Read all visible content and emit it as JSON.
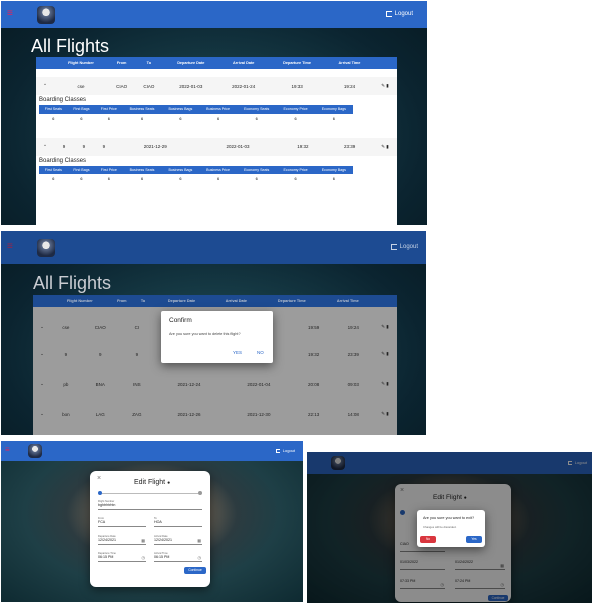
{
  "app": {
    "logout_label": "Logout",
    "page_title": "All Flights",
    "accent": "#2b67c7"
  },
  "flights_table": {
    "headers": [
      "Flight Number",
      "From",
      "To",
      "Departure Date",
      "Arrival Date",
      "Departure Time",
      "Arrival Time"
    ],
    "rows": [
      {
        "number": "cse",
        "from": "CIAO",
        "to": "CIAO",
        "dep_date": "2022-01-03",
        "arr_date": "2022-01-24",
        "dep_time": "19:33",
        "arr_time": "19:24"
      },
      {
        "number": "9",
        "from": "9",
        "to": "9",
        "dep_date": "2021-12-29",
        "arr_date": "2022-01-03",
        "dep_time": "19:32",
        "arr_time": "23:39"
      }
    ],
    "boarding_title": "Boarding Classes",
    "boarding_headers": [
      "First Seats",
      "First Bags",
      "First Price",
      "Business Seats",
      "Business Bags",
      "Business Price",
      "Economy Seats",
      "Economy Price",
      "Economy Bags"
    ],
    "boarding_values": [
      "6",
      "6",
      "6",
      "6",
      "6",
      "6",
      "6",
      "6",
      "6"
    ]
  },
  "delete_view": {
    "rows": [
      {
        "number": "cse",
        "from": "CIAO",
        "to": "CI",
        "dep_date": "",
        "arr_date": "",
        "dep_time": "19:59",
        "arr_time": "19:24"
      },
      {
        "number": "9",
        "from": "9",
        "to": "9",
        "dep_date": "2021-12-29",
        "arr_date": "2022-01-03",
        "dep_time": "19:32",
        "arr_time": "23:39"
      },
      {
        "number": "pb",
        "from": "BNA",
        "to": "INS",
        "dep_date": "2021-12-24",
        "arr_date": "2022-01-04",
        "dep_time": "20:08",
        "arr_time": "09:03"
      },
      {
        "number": "bon",
        "from": "LAG",
        "to": "ZAG",
        "dep_date": "2021-12-26",
        "arr_date": "2021-12-30",
        "dep_time": "22:13",
        "arr_time": "14:08"
      }
    ],
    "confirm": {
      "title": "Confirm",
      "message": "Are you sure you want to delete this flight?",
      "yes": "YES",
      "no": "NO"
    }
  },
  "edit_view": {
    "title": "Edit Flight",
    "flight_number_label": "Flight Number",
    "flight_number_value": "bghtrhtrhtn",
    "from_label": "From",
    "from_value": "FCA",
    "to_label": "To",
    "to_value": "HOA",
    "dep_date_label": "Departure Date",
    "dep_date_value": "12/24/2021",
    "arr_date_label": "Arrival Date",
    "arr_date_value": "12/24/2021",
    "dep_time_label": "Departure Time",
    "dep_time_value": "06:15 PM",
    "arr_time_label": "Arrival Time",
    "arr_time_value": "06:15 PM",
    "continue": "Continue"
  },
  "exit_view": {
    "title": "Edit Flight",
    "message": "Are you sure you want to exit?",
    "sub": "Changes will be discarded.",
    "no": "No",
    "yes": "Yes",
    "from_value": "CIAO",
    "dep_date_value": "01/03/2022",
    "arr_date_value": "01/24/2022",
    "dep_time_value": "07:33 PM",
    "arr_time_value": "07:24 PM",
    "continue": "Continue"
  }
}
